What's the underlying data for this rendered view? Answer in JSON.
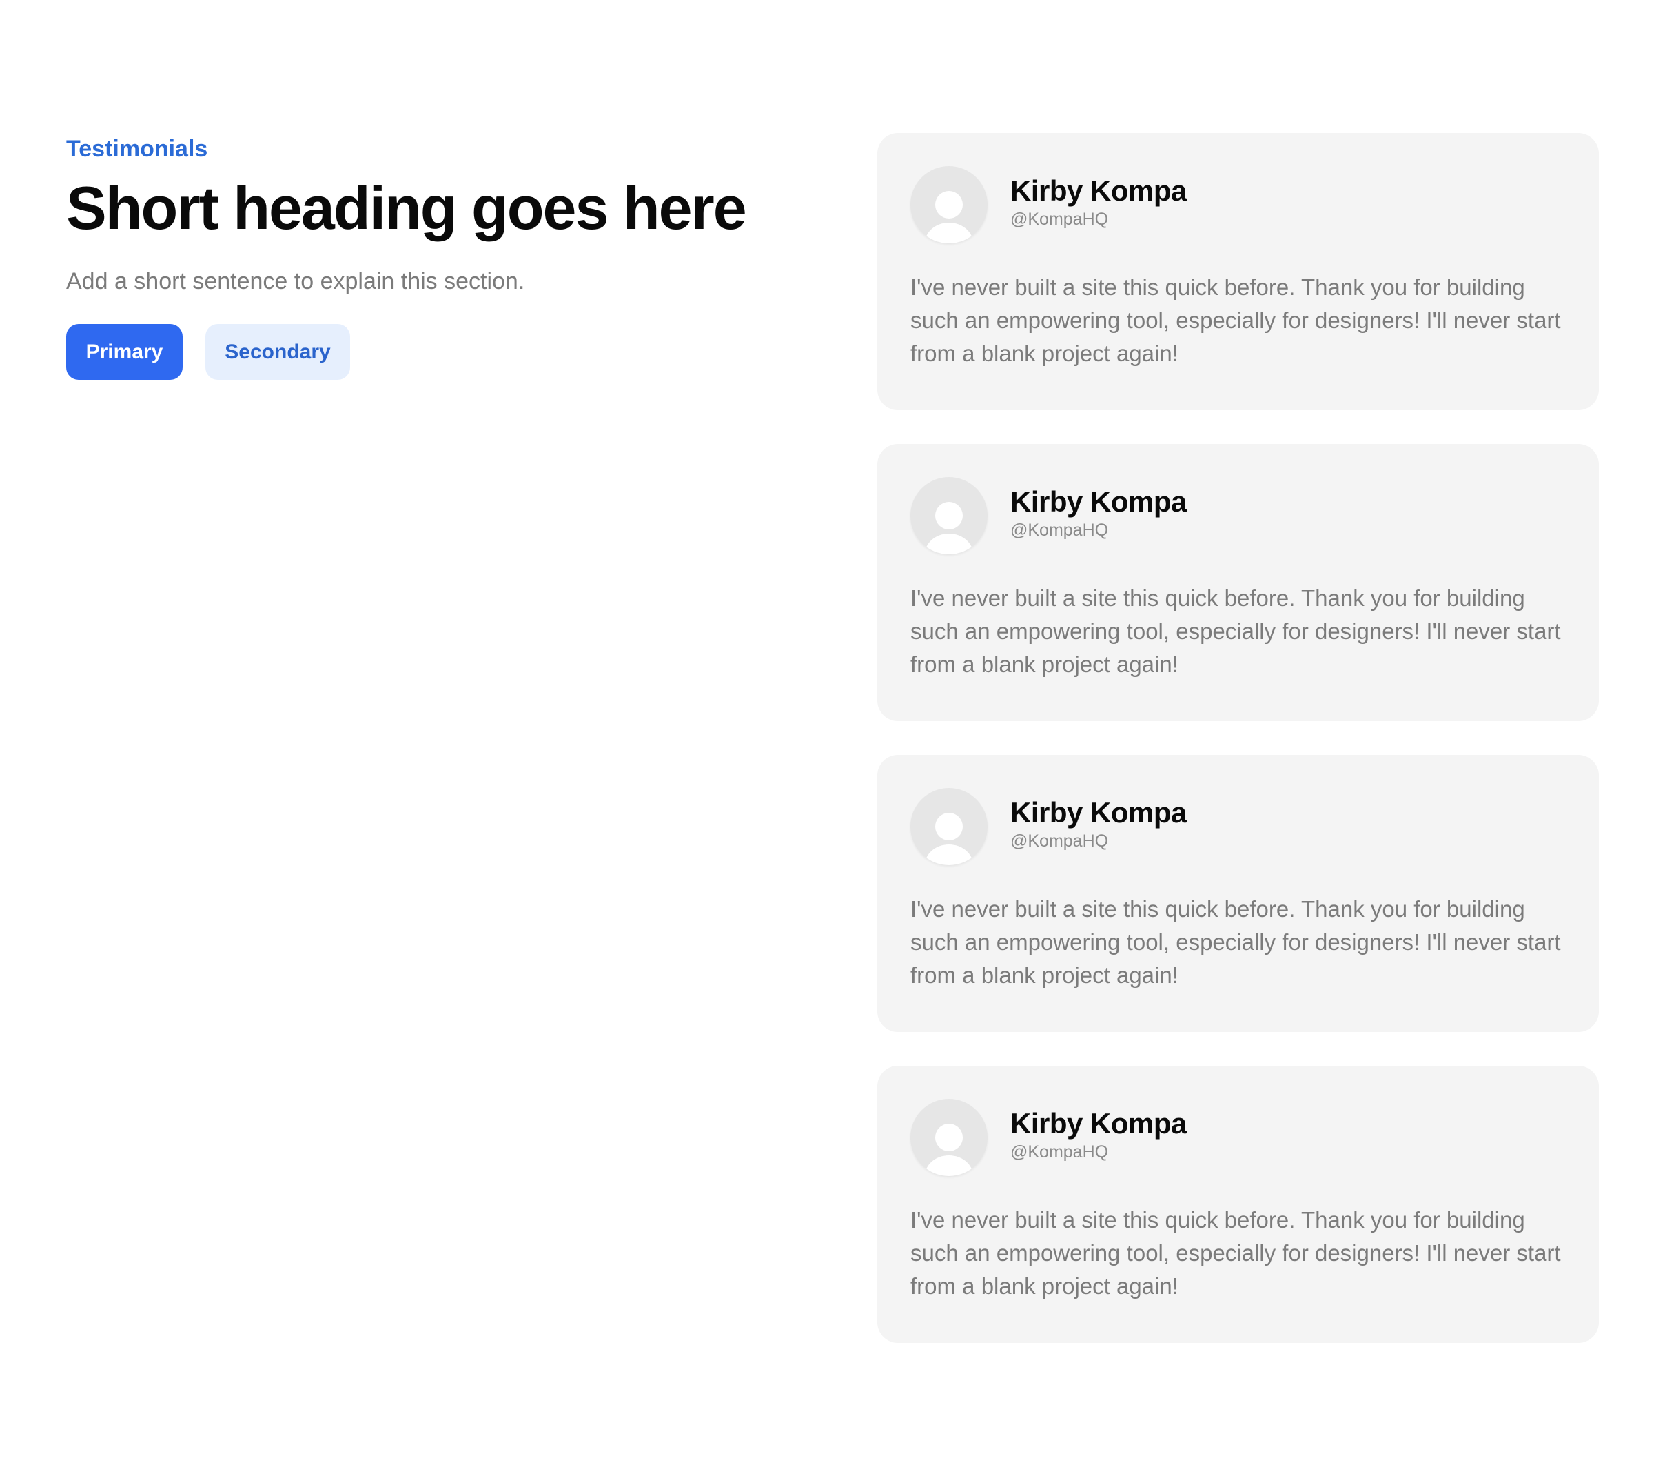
{
  "header": {
    "eyebrow": "Testimonials",
    "title": "Short heading goes here",
    "subtitle": "Add a short sentence to explain this section."
  },
  "actions": {
    "primary_label": "Primary",
    "secondary_label": "Secondary"
  },
  "colors": {
    "accent": "#2f69f0",
    "accent_text": "#2b6bd6",
    "secondary_bg": "#e6effd",
    "card_bg": "#f4f4f4",
    "muted_text": "#7b7b7b"
  },
  "testimonials": [
    {
      "avatar_icon": "user-avatar-placeholder-icon",
      "name": "Kirby Kompa",
      "handle": "@KompaHQ",
      "quote": "I've never built a site this quick before. Thank you for building such an empowering tool, especially for designers! I'll never start from a blank project again!"
    },
    {
      "avatar_icon": "user-avatar-placeholder-icon",
      "name": "Kirby Kompa",
      "handle": "@KompaHQ",
      "quote": "I've never built a site this quick before. Thank you for building such an empowering tool, especially for designers! I'll never start from a blank project again!"
    },
    {
      "avatar_icon": "user-avatar-placeholder-icon",
      "name": "Kirby Kompa",
      "handle": "@KompaHQ",
      "quote": "I've never built a site this quick before. Thank you for building such an empowering tool, especially for designers! I'll never start from a blank project again!"
    },
    {
      "avatar_icon": "user-avatar-placeholder-icon",
      "name": "Kirby Kompa",
      "handle": "@KompaHQ",
      "quote": "I've never built a site this quick before. Thank you for building such an empowering tool, especially for designers! I'll never start from a blank project again!"
    }
  ]
}
